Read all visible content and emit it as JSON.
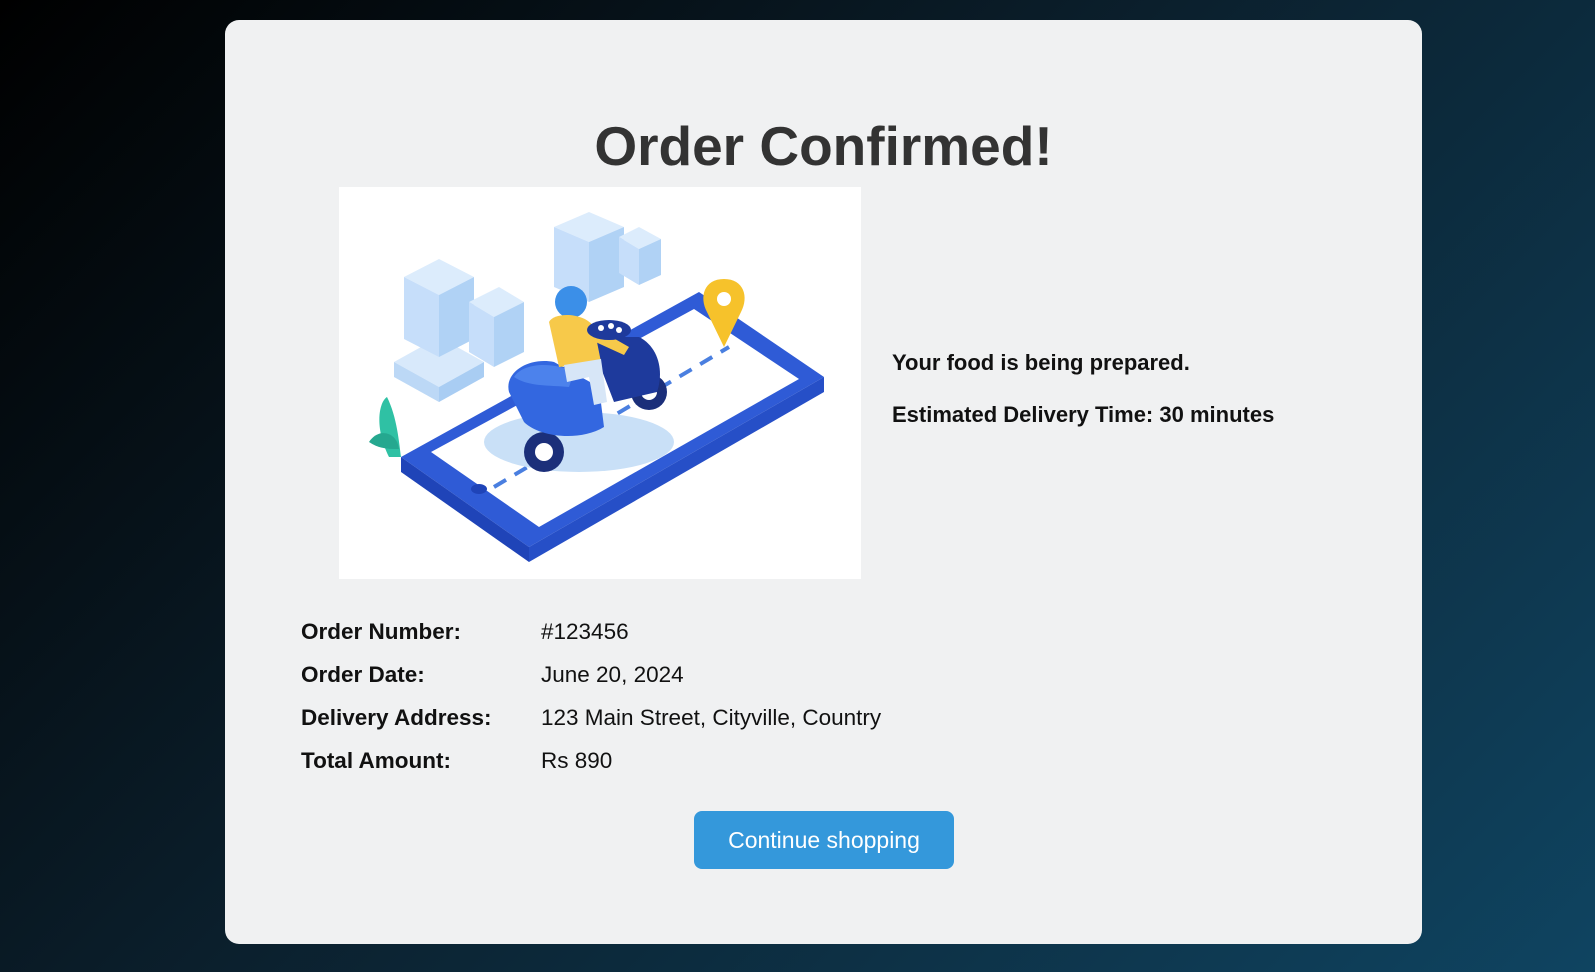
{
  "page": {
    "title": "Order Confirmed!"
  },
  "illustration": {
    "name": "delivery-scooter-illustration"
  },
  "status": {
    "preparing": "Your food is being prepared.",
    "estimate": "Estimated Delivery Time: 30 minutes"
  },
  "details": [
    {
      "label": "Order Number:",
      "value": "#123456"
    },
    {
      "label": "Order Date:",
      "value": "June 20, 2024"
    },
    {
      "label": "Delivery Address:",
      "value": "123 Main Street, Cityville, Country"
    },
    {
      "label": "Total Amount:",
      "value": "Rs 890"
    }
  ],
  "actions": {
    "continue_label": "Continue shopping"
  },
  "colors": {
    "accent": "#3498db",
    "card_bg": "#f0f1f2",
    "title": "#333333"
  }
}
